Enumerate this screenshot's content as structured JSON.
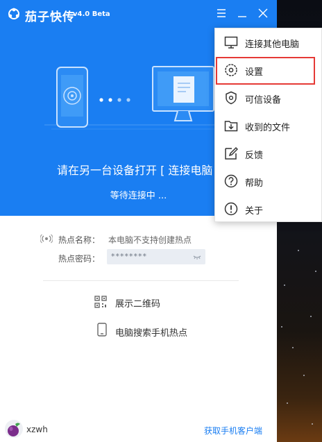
{
  "window": {
    "app_name": "茄子快传",
    "version": "v4.0 Beta",
    "accent_color": "#1a7ef2"
  },
  "title_controls": [
    {
      "icon": "menu-icon"
    },
    {
      "icon": "minimize-icon"
    },
    {
      "icon": "close-icon"
    }
  ],
  "header": {
    "title": "请在另一台设备打开 [ 连接电脑",
    "status": "等待连接中 ..."
  },
  "hotspot": {
    "name_label": "热点名称：",
    "name_value": "本电脑不支持创建热点",
    "password_label": "热点密码：",
    "password_value": "********"
  },
  "actions": {
    "show_qr": "展示二维码",
    "search_hotspot": "电脑搜索手机热点"
  },
  "footer": {
    "username": "xzwh",
    "get_client_link": "获取手机客户端"
  },
  "menu": {
    "items": [
      {
        "label": "连接其他电脑",
        "icon": "monitor-icon"
      },
      {
        "label": "设置",
        "icon": "settings-icon"
      },
      {
        "label": "可信设备",
        "icon": "shield-icon"
      },
      {
        "label": "收到的文件",
        "icon": "download-folder-icon"
      },
      {
        "label": "反馈",
        "icon": "edit-icon"
      },
      {
        "label": "帮助",
        "icon": "help-icon"
      },
      {
        "label": "关于",
        "icon": "info-icon"
      }
    ],
    "highlighted_item": "设置",
    "highlight_color": "#e53935"
  }
}
